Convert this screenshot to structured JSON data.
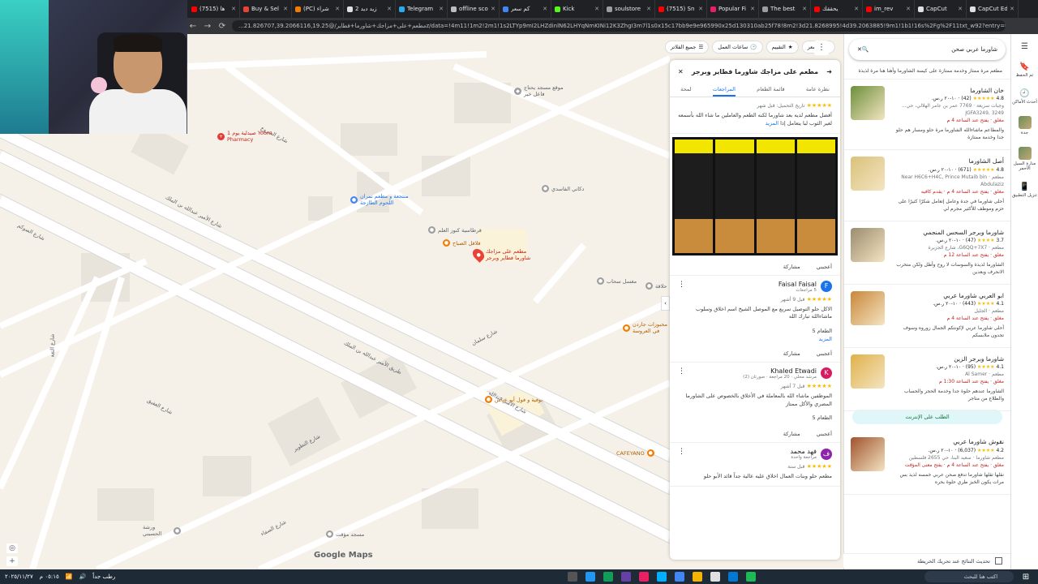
{
  "browser": {
    "tabs": [
      {
        "label": "(7515) ها",
        "color": "#ff0000"
      },
      {
        "label": "Buy & Sel",
        "color": "#ea4335"
      },
      {
        "label": "(PC) شراء",
        "color": "#f57c00"
      },
      {
        "label": "زيد ديد 2",
        "color": "#e0e0e0"
      },
      {
        "label": "Telegram",
        "color": "#2aabee"
      },
      {
        "label": "offline sco",
        "color": "#bdbdbd"
      },
      {
        "label": "كم سعر",
        "color": "#4285f4"
      },
      {
        "label": "Kick",
        "color": "#53fc18"
      },
      {
        "label": "soulstore",
        "color": "#9e9e9e"
      },
      {
        "label": "(7515) Sn",
        "color": "#ff0000"
      },
      {
        "label": "Popular Fi",
        "color": "#e91e63"
      },
      {
        "label": "The best",
        "color": "#9e9e9e"
      },
      {
        "label": "يحققك",
        "color": "#ff0000"
      },
      {
        "label": "im_rev",
        "color": "#ff0000"
      },
      {
        "label": "CapCut",
        "color": "#e0e0e0"
      },
      {
        "label": "CapCut Ed",
        "color": "#e0e0e0"
      }
    ],
    "url": "...مطعم+على+مزاجك+شاورما+فطاير/@21.826707,39.2066116,19.25z/data=!4m11!1m2!2m1!1s2LTYp9mI2LHZdinlN62LHYqNmKINi12K3ZhgI3m7l1s0x15c17bb9e9e965990x25d130310ab25f78!8m2!3d21.8268995!4d39.2063885!9m1!1b1!16s%2Fg%2F11txt_w92?entry=ttu&g_ep=EgoyMDI1MTExNy...",
    "back_label": "←",
    "forward_label": "→",
    "reload_label": "⟳"
  },
  "map": {
    "street_labels": [
      "شارع الشروع",
      "شارع الأمير عبدالله بن الملك",
      "طريق الأمير عبدالله بن الملك",
      "شارع الأمير عبدالله",
      "شارع الصوكم",
      "شارع الثقة",
      "شارع التطوير",
      "شارع الصفاء",
      "شارع سلمان",
      "شارع العقيق"
    ],
    "pois": [
      {
        "name": "صيدلية يوم 1 Yoom Pharmacy",
        "color": "#e53935",
        "icon": "+"
      },
      {
        "name": "موقع مسجد يحتاج فاعل خير",
        "color": "#9e9e9e",
        "icon": "◆"
      },
      {
        "name": "منتجعة و مطعم نمران اللحوم الطازجة",
        "color": "#4285f4",
        "icon": "●"
      },
      {
        "name": "دكاني الفاسدي",
        "color": "#9e9e9e",
        "icon": "●"
      },
      {
        "name": "قرطاسية كنوز العلم",
        "color": "#9e9e9e",
        "icon": "●"
      },
      {
        "name": "فلافل الصباح",
        "color": "#f57c00",
        "icon": "●"
      },
      {
        "name": "مطعم على مزاجك شاورما فطاير وبرجر",
        "color": "#ea4335",
        "icon": "●"
      },
      {
        "name": "حلاقة",
        "color": "#9e9e9e",
        "icon": "●"
      },
      {
        "name": "مغسل سحاب",
        "color": "#9e9e9e",
        "icon": "●"
      },
      {
        "name": "مخبوزات جاردن في العروسة",
        "color": "#f57c00",
        "icon": "●"
      },
      {
        "name": "بوفية و فول أبو عباس",
        "color": "#f57c00",
        "icon": "●"
      },
      {
        "name": "CAFEYANO",
        "color": "#f57c00",
        "icon": "●"
      },
      {
        "name": "مسجد مؤقت",
        "color": "#9e9e9e",
        "icon": "●"
      },
      {
        "name": "ورشة الحسيني",
        "color": "#9e9e9e",
        "icon": "●"
      }
    ],
    "logo": "Google Maps",
    "attribution": [
      "بيانات الخرائط ©2025 Google",
      "المملكة العربية السعودية",
      "الشروط",
      "الخصوصية",
      "إرسال ملاحظات حول المنتج",
      "200 قدم"
    ],
    "controls": {
      "locate": "◎",
      "zoom_in": "+",
      "zoom_out": "−",
      "pegman": "👤"
    }
  },
  "filters": {
    "chips": [
      "السعر",
      "التقييم",
      "ساعات العمل",
      "جميع الفلاتر"
    ]
  },
  "detail": {
    "title": "مطعم على مزاجك شاورما فطاير وبرجر",
    "tabs": [
      "نظرة عامة",
      "قائمة الطعام",
      "المراجعات",
      "لمحة"
    ],
    "first_review": {
      "date": "تاريخ التحميل: قبل شهر",
      "text": "أفضل مطعم لديه بعد شاورما لكنه الطعم والعاملين ما شاء الله بأسمعه لغير الثوب لبا يتعامل إذا",
      "more": "المزيد",
      "like": "أعجبني",
      "share": "مشاركة"
    },
    "reviews": [
      {
        "name": "Faisal Faisal",
        "initial": "F",
        "color": "#1a73e8",
        "meta": "5 مراجعات",
        "stars": "★★★★★",
        "date": "قبل 9 أشهر",
        "text": "الاكل حلو التوصيل سريع مع الموصل الشيخ اسم اخلاق وسلوب ماشاءالله تبارك الله",
        "more": "الطعام 5",
        "more2": "المزيد",
        "like": "أعجبني",
        "share": "مشاركة"
      },
      {
        "name": "Khaled Etwadi",
        "initial": "K",
        "color": "#d81b60",
        "meta": "مرشد محلي · 20 مراجعة · صورتان (2)",
        "stars": "★★★★★",
        "date": "قبل 7 أشهر",
        "text": "الموظفين ماشاء الله بالمعاملة في الأخلاق بالخصوص على الشاورما المصري والأكل ممتاز",
        "more": "الطعام 5",
        "like": "أعجبني",
        "share": "مشاركة"
      },
      {
        "name": "فهد محمد",
        "initial": "ف",
        "color": "#8e24aa",
        "meta": "مراجعة واحدة",
        "stars": "★★★★★",
        "date": "قبل سنة",
        "text": "مطعم حلو وبنات العمال اخلاق عليه عالية جداً قائد الأبو حلو",
        "more": "",
        "like": "",
        "share": ""
      }
    ]
  },
  "search": {
    "query": "شاورما عربي صحن",
    "placeholder": "بحث في خرائط Google",
    "close": "✕",
    "search_icon": "🔍"
  },
  "results": {
    "top_note": "مطعم مرة ممتاز وخدمة ممتازة على كيسة الشاورما وأهنا هنا مرة لذيذة",
    "items": [
      {
        "name": "خان الشاورما",
        "rating": "4.8",
        "stars": "★★★★★",
        "count": "(42)",
        "price": "١٠-٢٠ ر.س.",
        "type": "وجبات سريعة",
        "address": "7769 عمر بن عامر الهلالي، حي...",
        "addr2": "JGFA3249, 3249",
        "status": "مغلق · يفتح عند الساعة 4 م",
        "quote": "والمطاعم ماشاءالله الشاورما مرة حلو ومسار هم حلو جدا وخدمة ممتازة",
        "thumb": "#6b8f3a"
      },
      {
        "name": "أصل الشاورما",
        "rating": "4.8",
        "stars": "★★★★★",
        "count": "(671)",
        "price": "١٠-٢٠ ر.س.",
        "type": "مطعم",
        "address": "Near H6C6+H4C, Prince Mutaib bin Abdulaziz",
        "addr2": "",
        "status": "مغلق · يفتح عند الساعة 4 م · يقدم كافيه",
        "quote": "أحلى شاورما في جدة وعامل إتعامل شكرًا كثيرًا على حزم وموظف للأكثير مجرم لي",
        "thumb": "#d9c27a"
      },
      {
        "name": "شاورما وبرجر السحس المنجمي",
        "rating": "3.7",
        "stars": "★★★★",
        "count": "(47)",
        "price": "١٠-٢٠ ر.س.",
        "type": "مطعم",
        "address": "G6QQ+7X7، شارع الجزيرة",
        "addr2": "",
        "status": "مغلق · يفتح عند الساعة 12 م",
        "quote": "الشاورما لذيذة والسوسات لا روح وأظل ولكن متخرب الانحرف وبعدين",
        "thumb": "#9b8b70"
      },
      {
        "name": "ابو العربي شاورما عربي",
        "rating": "4.1",
        "stars": "★★★★",
        "count": "(443)",
        "price": "١٠-٢٠ ر.س.",
        "type": "مطعم",
        "address": "الجليل",
        "addr2": "",
        "status": "مغلق · يفتح عند الساعة 4 م",
        "quote": "أحلى شاورما عربي لإكونتكم الجمال زوروه وسوف تجدون ملابسكم",
        "thumb": "#c9873a"
      },
      {
        "name": "شاورما وبرجر الزين",
        "rating": "4.1",
        "stars": "★★★★",
        "count": "(95)",
        "price": "١٠-٢٠ ر.س.",
        "type": "مطعم",
        "address": "Al Samer",
        "addr2": "",
        "status": "مغلق · يفتح عند الساعة 1:30 م",
        "quote": "الشاورما عندهم حلوة جدا وخدمة الحجز والحساب والطلاع من متاجر",
        "thumb": "#e0b14a"
      },
      {
        "name": "نقوش شاورما عربي",
        "rating": "4.2",
        "stars": "★★★★",
        "count": "(6,037)",
        "price": "١٠-٢٠ ر.س.",
        "type": "مطعم شاورما",
        "address": "سعيد البنا، حي 2655 فلسطين",
        "addr2": "",
        "status": "مغلق · يفتح عند الساعة 4 م · يفتح معنى المؤقت",
        "quote": "نقلها تقلها شاورما تدفع صحن عربي خمسه لذيذ بس مرات يكون الخبز طري حلوة بحره",
        "thumb": "#a0522d"
      }
    ],
    "order_label": "الطلب على الإنترنت",
    "update_label": "تحديث النتائج عند تحريك الخريطة"
  },
  "rail": {
    "items": [
      {
        "icon": "☰",
        "label": ""
      },
      {
        "icon": "🔖",
        "label": "تم الحفظ"
      },
      {
        "icon": "🕘",
        "label": "أحدث الأماكن"
      },
      {
        "icon": "",
        "label": "جدة"
      },
      {
        "icon": "",
        "label": "منارة السيل الأحمر"
      },
      {
        "icon": "📱",
        "label": "تنزيل التطبيق"
      }
    ]
  },
  "taskbar": {
    "time": "٠٥:١٥ م",
    "date": "٢٠٢٥/١١/٢٧",
    "weather": "رطب جداً",
    "search": "اكتب هنا للبحث",
    "start": "⊞"
  }
}
